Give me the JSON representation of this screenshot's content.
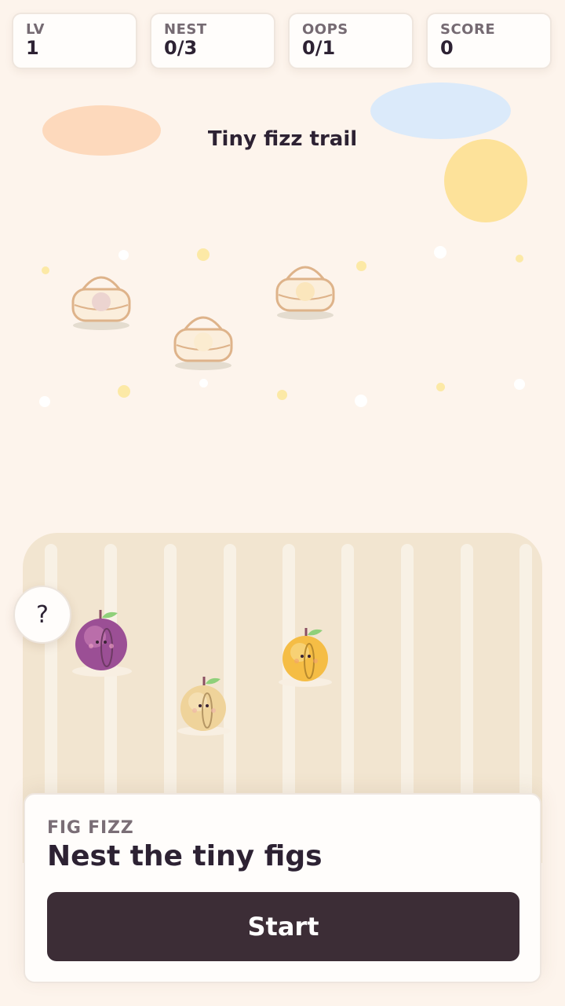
{
  "hud": [
    {
      "label": "LV",
      "value": "1"
    },
    {
      "label": "NEST",
      "value": "0/3"
    },
    {
      "label": "OOPS",
      "value": "0/1"
    },
    {
      "label": "SCORE",
      "value": "0"
    }
  ],
  "level_title": "Tiny fizz trail",
  "help_label": "?",
  "panel": {
    "eyebrow": "FIG FIZZ",
    "heading": "Nest the tiny figs",
    "start_label": "Start"
  },
  "colors": {
    "background": "#fdf4ec",
    "button_dark": "#3c2d36",
    "fig_purple": "#9b4f95",
    "fig_tan": "#efd39a",
    "fig_orange": "#f5bd45",
    "sun": "#fde29a",
    "cloud_peach": "#fdd9bc",
    "cloud_blue": "#dbeafa"
  },
  "icons": [
    "basket-icon",
    "fig-icon",
    "question-icon"
  ]
}
